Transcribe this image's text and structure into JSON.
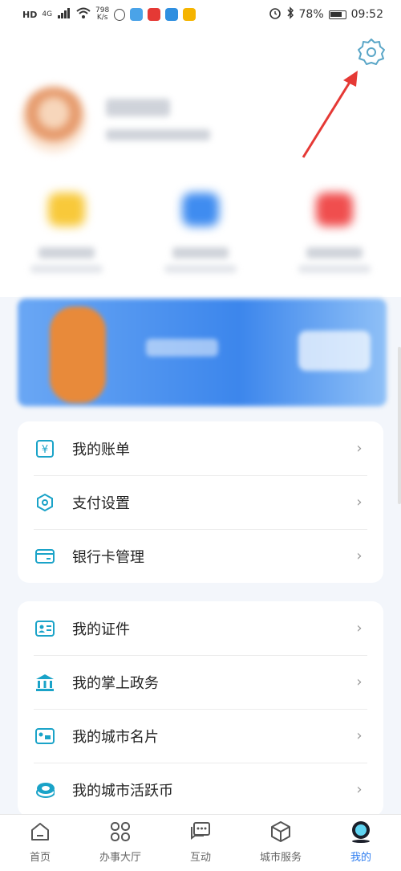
{
  "status_bar": {
    "left_labels": [
      "HD",
      "4G"
    ],
    "net_speed_value": "798",
    "net_speed_unit": "K/s",
    "battery_percent": "78%",
    "time": "09:52"
  },
  "settings_icon": "gear-icon",
  "menu_card_1": [
    {
      "label": "我的账单",
      "icon": "bill-icon"
    },
    {
      "label": "支付设置",
      "icon": "payment-settings-icon"
    },
    {
      "label": "银行卡管理",
      "icon": "bank-card-icon"
    }
  ],
  "menu_card_2": [
    {
      "label": "我的证件",
      "icon": "id-card-icon"
    },
    {
      "label": "我的掌上政务",
      "icon": "government-icon"
    },
    {
      "label": "我的城市名片",
      "icon": "city-card-icon"
    },
    {
      "label": "我的城市活跃币",
      "icon": "coin-icon"
    }
  ],
  "tabs": [
    {
      "label": "首页",
      "icon": "home-icon"
    },
    {
      "label": "办事大厅",
      "icon": "services-icon"
    },
    {
      "label": "互动",
      "icon": "chat-icon"
    },
    {
      "label": "城市服务",
      "icon": "city-service-icon"
    },
    {
      "label": "我的",
      "icon": "profile-icon",
      "active": true
    }
  ],
  "colors": {
    "accent": "#2c7cf0",
    "icon_teal": "#1aa3c8",
    "arrow": "#e53935"
  }
}
